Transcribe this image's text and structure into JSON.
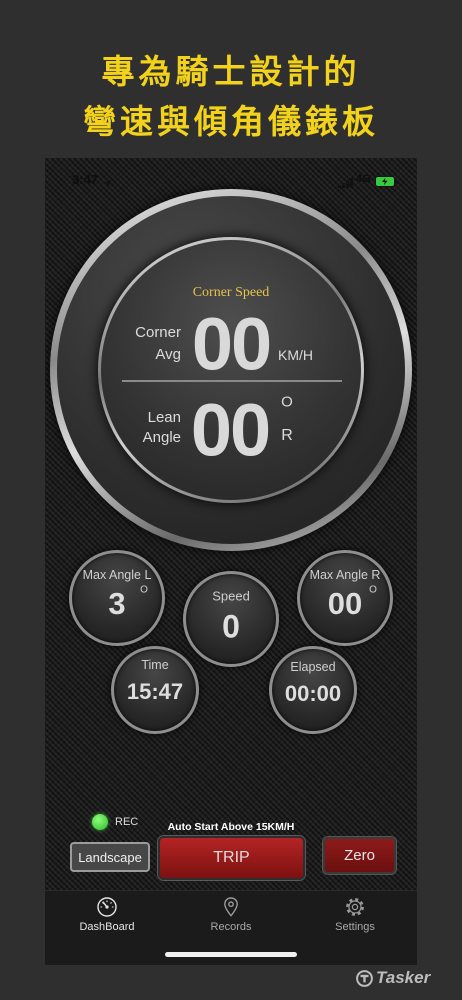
{
  "promo": {
    "line1": "專為騎士設計的",
    "line2": "彎速與傾角儀錶板"
  },
  "status_bar": {
    "time": "3:47",
    "network": "4G"
  },
  "main_gauge": {
    "title": "Corner Speed",
    "corner_label_1": "Corner",
    "corner_label_2": "Avg",
    "corner_value": "00",
    "corner_unit": "KM/H",
    "lean_label_1": "Lean",
    "lean_label_2": "Angle",
    "lean_value": "00",
    "lean_degree": "O",
    "lean_side": "R"
  },
  "gauges": {
    "max_angle_l": {
      "label": "Max Angle L",
      "value": "3",
      "degree": "O"
    },
    "speed": {
      "label": "Speed",
      "value": "0"
    },
    "max_angle_r": {
      "label": "Max Angle R",
      "value": "00",
      "degree": "O"
    },
    "time": {
      "label": "Time",
      "value": "15:47"
    },
    "elapsed": {
      "label": "Elapsed",
      "value": "00:00"
    }
  },
  "controls": {
    "rec_label": "REC",
    "auto_start": "Auto Start Above 15KM/H",
    "landscape": "Landscape",
    "trip": "TRIP",
    "zero": "Zero"
  },
  "tabs": [
    {
      "label": "DashBoard",
      "icon": "dashboard-icon",
      "active": true
    },
    {
      "label": "Records",
      "icon": "location-pin-icon",
      "active": false
    },
    {
      "label": "Settings",
      "icon": "gear-icon",
      "active": false
    }
  ],
  "watermark": {
    "text": "Tasker"
  },
  "colors": {
    "promo_yellow": "#f2d21b",
    "title_gold": "#e6c24a",
    "rec_green": "#4cd137",
    "trip_red": "#a51d1d",
    "zero_red": "#7d1515",
    "battery_green": "#38c940"
  }
}
